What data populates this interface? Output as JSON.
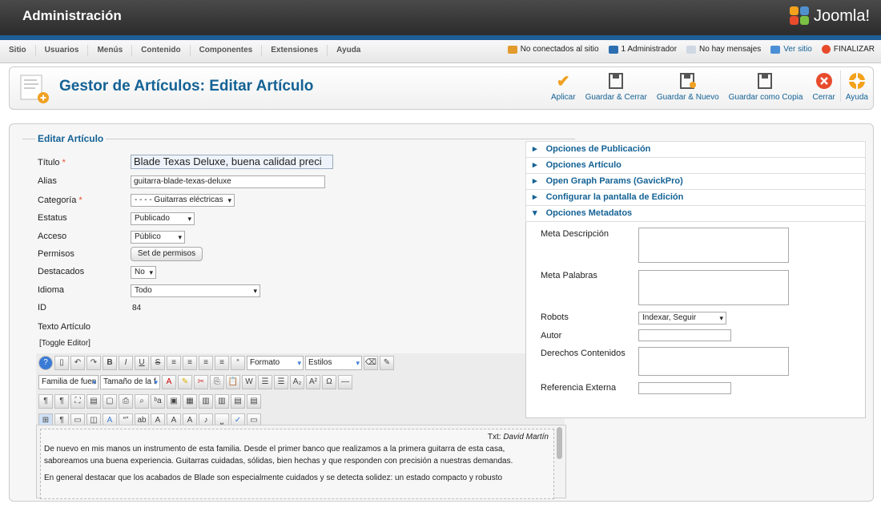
{
  "app": {
    "title": "Administración",
    "brand": "Joomla!"
  },
  "menu": {
    "items": [
      "Sitio",
      "Usuarios",
      "Menús",
      "Contenido",
      "Componentes",
      "Extensiones",
      "Ayuda"
    ]
  },
  "status": {
    "offline": "No conectados al sitio",
    "admins": "1 Administrador",
    "messages": "No hay mensajes",
    "view_site": "Ver sitio",
    "logout": "FINALIZAR"
  },
  "page": {
    "title": "Gestor de Artículos: Editar Artículo"
  },
  "toolbar": {
    "apply": "Aplicar",
    "save_close": "Guardar & Cerrar",
    "save_new": "Guardar & Nuevo",
    "save_copy": "Guardar como Copia",
    "close": "Cerrar",
    "help": "Ayuda"
  },
  "form": {
    "legend": "Editar Artículo",
    "title_label": "Título",
    "title_value": "Blade Texas Deluxe, buena calidad preci",
    "alias_label": "Alias",
    "alias_value": "guitarra-blade-texas-deluxe",
    "category_label": "Categoría",
    "category_value": "- - - - Guitarras eléctricas",
    "state_label": "Estatus",
    "state_value": "Publicado",
    "access_label": "Acceso",
    "access_value": "Público",
    "permissions_label": "Permisos",
    "permissions_button": "Set de permisos",
    "featured_label": "Destacados",
    "featured_value": "No",
    "language_label": "Idioma",
    "language_value": "Todo",
    "id_label": "ID",
    "id_value": "84",
    "text_label": "Texto Artículo",
    "toggle_editor": "[Toggle Editor]"
  },
  "editor": {
    "format": "Formato",
    "styles": "Estilos",
    "font_family": "Familia de fuen",
    "font_size": "Tamaño de la f",
    "byline_prefix": "Txt: ",
    "byline_author": "David Martín",
    "paragraph1": "De nuevo en mis manos un instrumento de esta familia. Desde el primer banco que realizamos a la primera guitarra de esta casa, saboreamos una buena experiencia. Guitarras cuidadas, sólidas, bien hechas y que responden con precisión a nuestras demandas.",
    "paragraph2": "En general destacar que los acabados de Blade son especialmente cuidados y se detecta solidez: un estado compacto y robusto"
  },
  "panels": {
    "publish": "Opciones de Publicación",
    "article": "Opciones Artículo",
    "opengraph": "Open Graph Params (GavickPro)",
    "edit_screen": "Configurar la pantalla de Edición",
    "metadata": "Opciones Metadatos"
  },
  "metadata": {
    "desc_label": "Meta Descripción",
    "keywords_label": "Meta Palabras",
    "robots_label": "Robots",
    "robots_value": "Indexar, Seguir",
    "author_label": "Autor",
    "rights_label": "Derechos Contenidos",
    "xref_label": "Referencia Externa"
  },
  "colors": {
    "link": "#146295",
    "menubar_blue": "#1e5e96",
    "apply": "#f0a020",
    "close": "#e84b2c"
  }
}
